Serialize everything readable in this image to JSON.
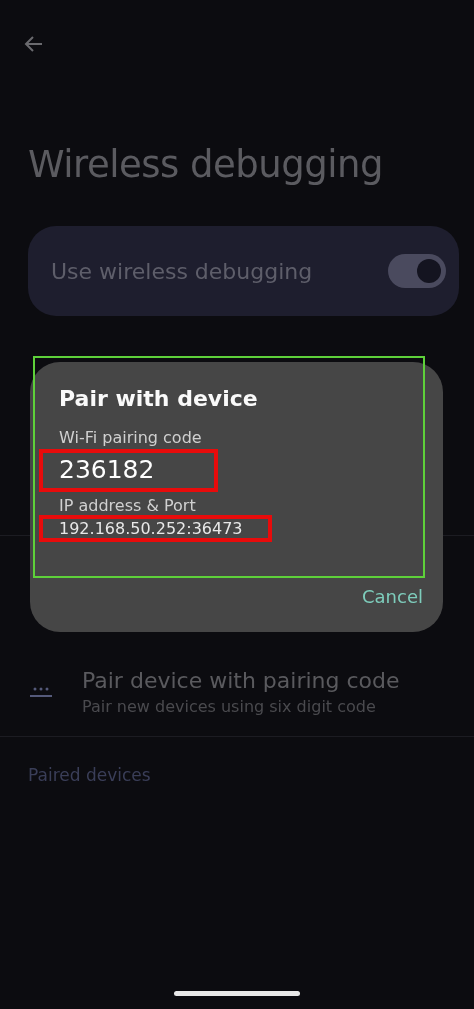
{
  "page": {
    "title": "Wireless debugging"
  },
  "main_toggle": {
    "label": "Use wireless debugging",
    "on": true
  },
  "pair_item": {
    "title": "Pair device with pairing code",
    "subtitle": "Pair new devices using six digit code"
  },
  "section_header": "Paired devices",
  "dialog": {
    "title": "Pair with device",
    "outlined": true,
    "fields": [
      {
        "label": "Wi-Fi pairing code",
        "value": "236182",
        "kind": "code",
        "highlighted": true
      },
      {
        "label": "IP address & Port",
        "value": "192.168.50.252:36473",
        "kind": "address",
        "highlighted": true
      }
    ],
    "buttons": [
      "Cancel"
    ]
  }
}
